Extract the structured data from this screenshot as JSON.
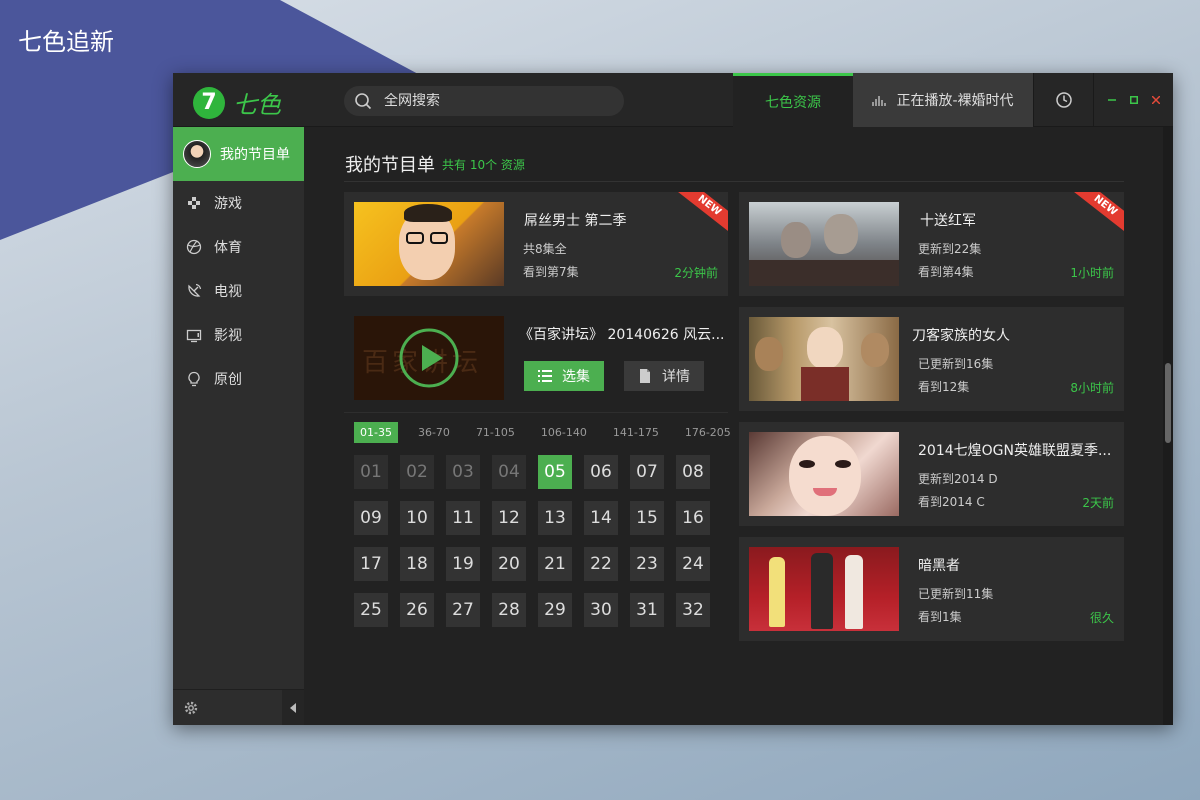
{
  "desktop": {
    "title": "七色追新"
  },
  "app": {
    "logo_digit": "7",
    "logo_text": "七色"
  },
  "search": {
    "placeholder": "全网搜索"
  },
  "tabs": {
    "resources": "七色资源",
    "now_playing": "正在播放-裸婚时代"
  },
  "sidebar": {
    "profile_label": "我的节目单",
    "items": [
      {
        "label": "游戏",
        "icon": "gamepad-icon"
      },
      {
        "label": "体育",
        "icon": "basketball-icon"
      },
      {
        "label": "电视",
        "icon": "satellite-icon"
      },
      {
        "label": "影视",
        "icon": "tv-icon"
      },
      {
        "label": "原创",
        "icon": "lightbulb-icon"
      }
    ]
  },
  "main": {
    "title": "我的节目单",
    "count": "共有 10个 资源"
  },
  "cards": [
    {
      "title": "屌丝男士 第二季",
      "line1": "共8集全",
      "line2": "看到第7集",
      "time": "2分钟前",
      "badge": "NEW"
    },
    {
      "title": "十送红军",
      "line1": "更新到22集",
      "line2": "看到第4集",
      "time": "1小时前",
      "badge": "NEW"
    },
    {
      "title": "刀客家族的女人",
      "line1": "已更新到16集",
      "line2": "看到12集",
      "time": "8小时前"
    },
    {
      "title": "2014七煌OGN英雄联盟夏季...",
      "line1": "更新到2014 D",
      "line2": "看到2014 C",
      "time": "2天前"
    },
    {
      "title": "暗黑者",
      "line1": "已更新到11集",
      "line2": "看到1集",
      "time": "很久"
    }
  ],
  "featured": {
    "title": "《百家讲坛》 20140626 风云...",
    "thumb_text": "百家讲坛",
    "select_label": "选集",
    "detail_label": "详情"
  },
  "episodes": {
    "ranges": [
      "01-35",
      "36-70",
      "71-105",
      "106-140",
      "141-175",
      "176-205"
    ],
    "active_range": 0,
    "items": [
      "01",
      "02",
      "03",
      "04",
      "05",
      "06",
      "07",
      "08",
      "09",
      "10",
      "11",
      "12",
      "13",
      "14",
      "15",
      "16",
      "17",
      "18",
      "19",
      "20",
      "21",
      "22",
      "23",
      "24",
      "25",
      "26",
      "27",
      "28",
      "29",
      "30",
      "31",
      "32"
    ],
    "watched_count": 4,
    "current_index": 4
  },
  "colors": {
    "accent": "#4caf50",
    "accent_text": "#3cc64a",
    "badge": "#e33b30"
  }
}
